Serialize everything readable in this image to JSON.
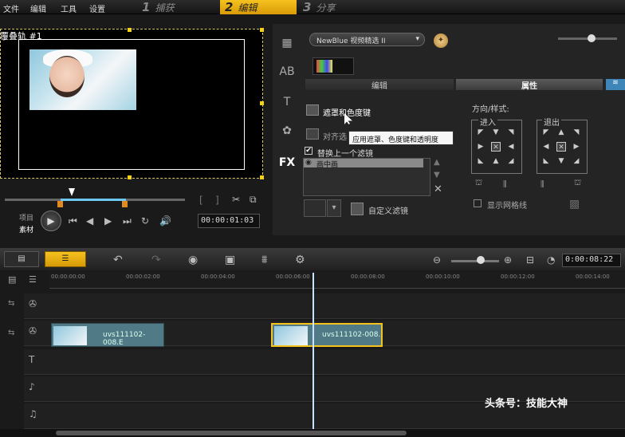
{
  "menu": {
    "file": "文件",
    "edit": "编辑",
    "tools": "工具",
    "settings": "设置"
  },
  "steps": [
    {
      "num": "1",
      "label": "捕获"
    },
    {
      "num": "2",
      "label": "编辑"
    },
    {
      "num": "3",
      "label": "分享"
    }
  ],
  "preview": {
    "title": "覆叠轨 #1",
    "timecode": "00:00:01:03",
    "labels": {
      "project": "项目",
      "clip": "素材"
    }
  },
  "effects": {
    "dropdown": "NewBlue 视频精选 II",
    "tabs": {
      "edit": "编辑",
      "attr": "属性"
    },
    "mask": "遮罩和色度键",
    "align": "对齐选",
    "tooltip": "应用遮罩、色度键和透明度",
    "replace_filter": "替换上一个滤镜",
    "filter_item": "画中画",
    "custom_filter": "自定义滤镜",
    "direction_title": "方向/样式:",
    "enter": "进入",
    "exit": "退出",
    "show_grid": "显示网格线"
  },
  "timeline": {
    "timecode": "0:00:08:22",
    "ticks": [
      "00:00:00:00",
      "00:00:02:00",
      "00:00:04:00",
      "00:00:06:00",
      "00:00:08:00",
      "00:00:10:00",
      "00:00:12:00",
      "00:00:14:00"
    ],
    "clip1": "uvs111102-008.E",
    "clip2": "uvs111102-008."
  },
  "watermark": "头条号：技能大神"
}
